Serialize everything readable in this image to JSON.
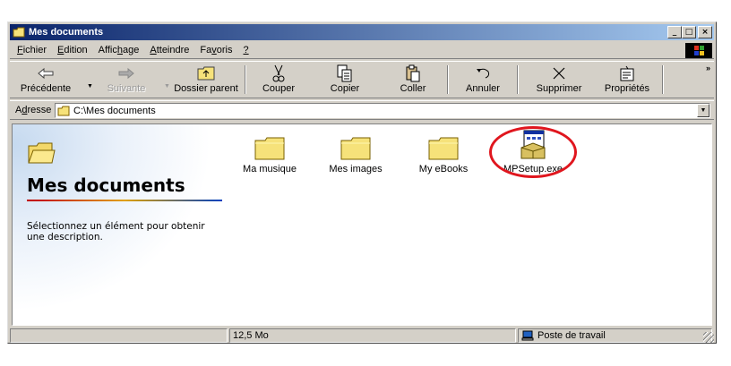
{
  "window": {
    "title": "Mes documents"
  },
  "menu": [
    {
      "label": "Fichier",
      "accel": "F",
      "rest": "ichier"
    },
    {
      "label": "Edition",
      "accel": "E",
      "rest": "dition"
    },
    {
      "label": "Affichage",
      "pre": "Affic",
      "accel": "h",
      "rest": "age"
    },
    {
      "label": "Atteindre",
      "accel": "A",
      "rest": "tteindre"
    },
    {
      "label": "Favoris",
      "pre": "Fa",
      "accel": "v",
      "rest": "oris"
    },
    {
      "label": "?",
      "accel": "?",
      "rest": ""
    }
  ],
  "toolbar": {
    "back": "Précédente",
    "forward": "Suivante",
    "up": "Dossier parent",
    "cut": "Couper",
    "copy": "Copier",
    "paste": "Coller",
    "undo": "Annuler",
    "delete": "Supprimer",
    "properties": "Propriétés"
  },
  "address": {
    "label_pre": "A",
    "label_accel": "d",
    "label_rest": "resse",
    "value": "C:\\Mes documents"
  },
  "left_pane": {
    "title": "Mes documents",
    "description": "Sélectionnez un élément pour obtenir une description."
  },
  "files": [
    {
      "name": "Ma musique",
      "type": "folder"
    },
    {
      "name": "Mes images",
      "type": "folder"
    },
    {
      "name": "My eBooks",
      "type": "folder"
    },
    {
      "name": "MPSetup.exe",
      "type": "setup"
    }
  ],
  "status": {
    "size": "12,5 Mo",
    "zone": "Poste de travail"
  },
  "colors": {
    "title_start": "#0a246a",
    "title_end": "#a6caf0",
    "highlight": "#e0161e",
    "folder": "#f6e27a"
  }
}
